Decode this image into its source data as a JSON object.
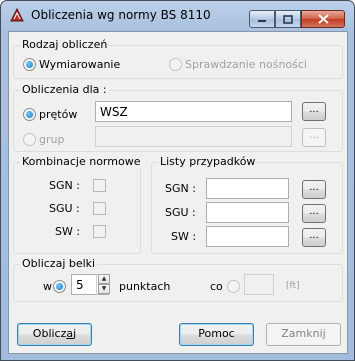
{
  "window": {
    "title": "Obliczenia wg normy BS 8110"
  },
  "rodzaj": {
    "label": "Rodzaj obliczeń",
    "option1": "Wymiarowanie",
    "option2": "Sprawdzanie nośności"
  },
  "obliczenia_dla": {
    "label": "Obliczenia dla :",
    "pretow_label": "prętów",
    "pretow_value": "WSZ",
    "grup_label": "grup",
    "grup_value": "",
    "browse_label": "..."
  },
  "kombinacje": {
    "label": "Kombinacje normowe",
    "sgn": "SGN :",
    "sgu": "SGU :",
    "sw": "SW :"
  },
  "listy": {
    "label": "Listy przypadków",
    "sgn": "SGN :",
    "sgu": "SGU :",
    "sw": "SW :",
    "sgn_value": "",
    "sgu_value": "",
    "sw_value": "",
    "browse_label": "..."
  },
  "belki": {
    "label": "Obliczaj belki",
    "w_label": "w",
    "points_value": "5",
    "points_unit": "punktach",
    "co_label": "co",
    "co_value": "",
    "unit": "[ft]"
  },
  "buttons": {
    "calculate": "Oblicz",
    "calculate_underlined": "a",
    "calculate_after": "j",
    "help": "Pomoc",
    "close": "Zamknij"
  }
}
